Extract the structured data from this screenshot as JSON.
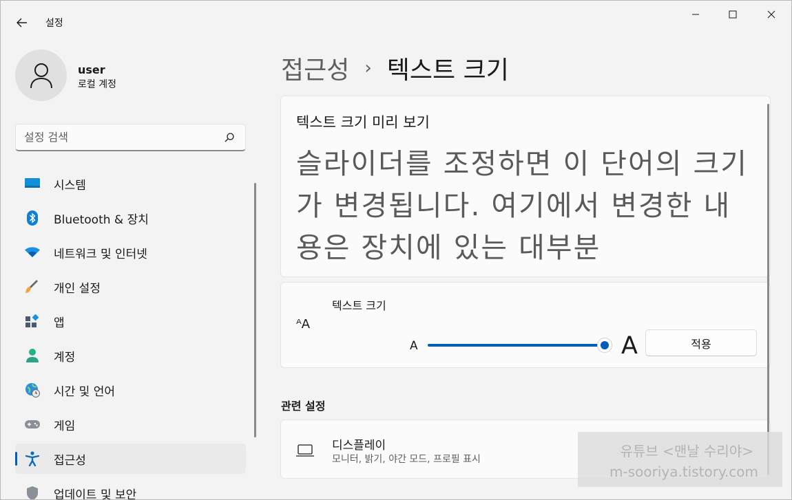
{
  "window": {
    "app_title": "설정"
  },
  "user": {
    "name": "user",
    "account_type": "로컬 계정"
  },
  "search": {
    "placeholder": "설정 검색"
  },
  "nav": {
    "items": [
      {
        "label": "시스템",
        "icon": "monitor-icon"
      },
      {
        "label": "Bluetooth & 장치",
        "icon": "bluetooth-icon"
      },
      {
        "label": "네트워크 및 인터넷",
        "icon": "wifi-icon"
      },
      {
        "label": "개인 설정",
        "icon": "brush-icon"
      },
      {
        "label": "앱",
        "icon": "apps-icon"
      },
      {
        "label": "계정",
        "icon": "person-icon"
      },
      {
        "label": "시간 및 언어",
        "icon": "globe-clock-icon"
      },
      {
        "label": "게임",
        "icon": "gamepad-icon"
      },
      {
        "label": "접근성",
        "icon": "accessibility-icon",
        "active": true
      },
      {
        "label": "업데이트 및 보안",
        "icon": "shield-icon"
      }
    ]
  },
  "breadcrumb": {
    "parent": "접근성",
    "separator": "›",
    "current": "텍스트 크기"
  },
  "preview": {
    "title": "텍스트 크기 미리 보기",
    "text": "슬라이더를 조정하면 이 단어의 크기가 변경됩니다. 여기에서 변경한 내용은 장치에 있는 대부분"
  },
  "text_size": {
    "label": "텍스트 크기",
    "icon_glyph": "ᴬA",
    "small_a": "A",
    "big_a": "A",
    "slider_value_fraction": 1.0,
    "apply_label": "적용"
  },
  "related": {
    "header": "관련 설정",
    "display": {
      "title": "디스플레이",
      "subtitle": "모니터, 밝기, 야간 모드, 프로필 표시"
    }
  },
  "watermark": {
    "line1": "유튜브 <맨날 수리야>",
    "line2": "m-sooriya.tistory.com"
  },
  "colors": {
    "accent": "#005fb8",
    "background": "#f3f3f3",
    "card": "#fbfbfb"
  }
}
